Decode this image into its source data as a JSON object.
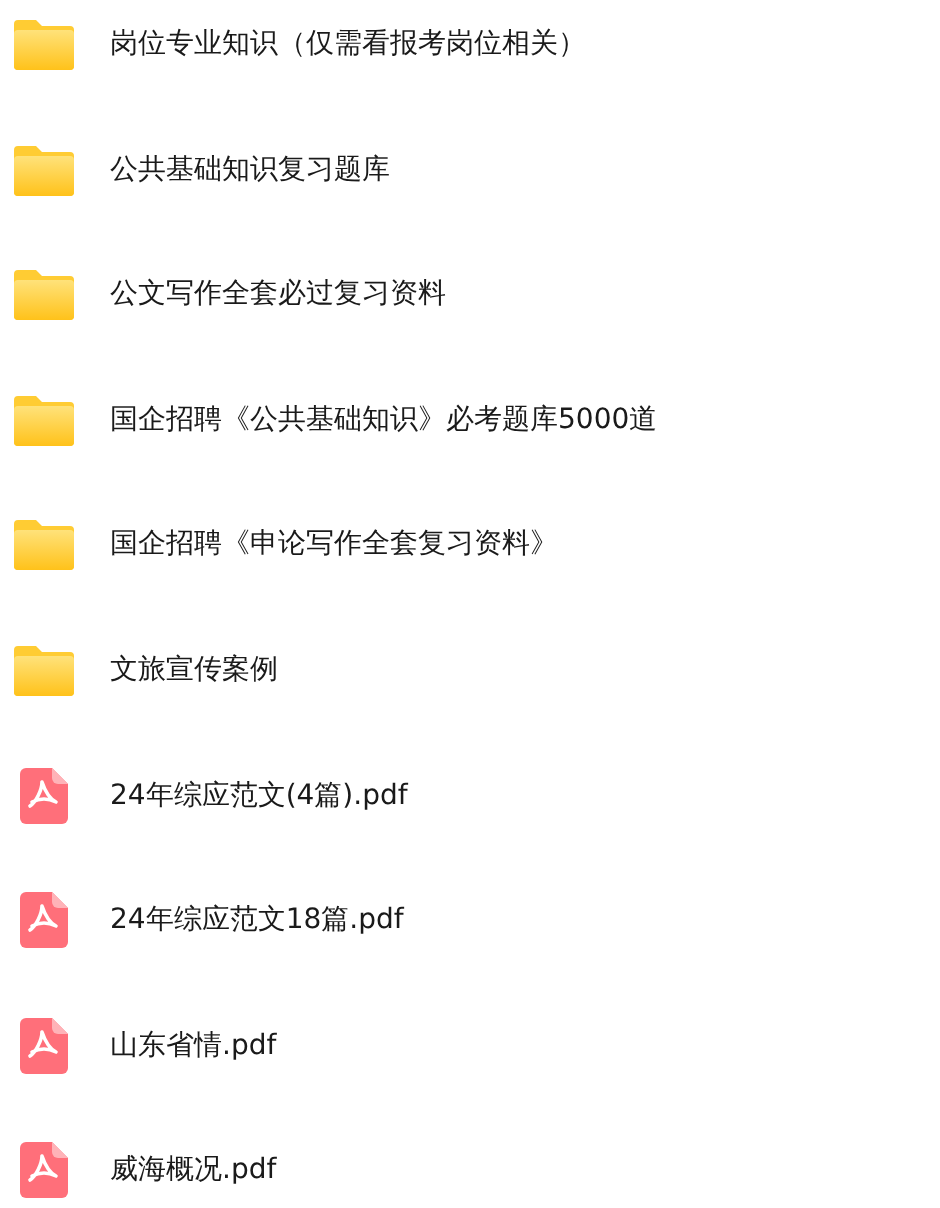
{
  "files": [
    {
      "kind": "folder",
      "name": "岗位专业知识（仅需看报考岗位相关）"
    },
    {
      "kind": "folder",
      "name": "公共基础知识复习题库"
    },
    {
      "kind": "folder",
      "name": "公文写作全套必过复习资料"
    },
    {
      "kind": "folder",
      "name": "国企招聘《公共基础知识》必考题库5000道"
    },
    {
      "kind": "folder",
      "name": "国企招聘《申论写作全套复习资料》"
    },
    {
      "kind": "folder",
      "name": "文旅宣传案例"
    },
    {
      "kind": "pdf",
      "name": "24年综应范文(4篇).pdf"
    },
    {
      "kind": "pdf",
      "name": "24年综应范文18篇.pdf"
    },
    {
      "kind": "pdf",
      "name": "山东省情.pdf"
    },
    {
      "kind": "pdf",
      "name": "威海概况.pdf"
    }
  ]
}
